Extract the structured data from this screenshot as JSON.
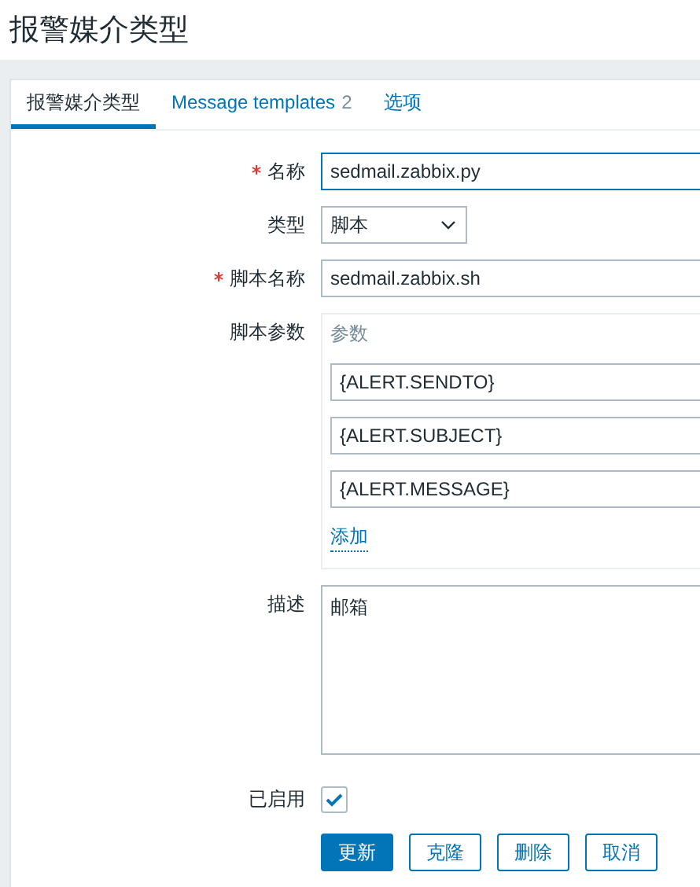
{
  "page": {
    "title": "报警媒介类型"
  },
  "tabs": [
    {
      "label": "报警媒介类型",
      "selected": true
    },
    {
      "label": "Message templates",
      "count": "2",
      "selected": false
    },
    {
      "label": "选项",
      "selected": false
    }
  ],
  "form": {
    "name": {
      "label": "名称",
      "required": true,
      "value": "sedmail.zabbix.py"
    },
    "type": {
      "label": "类型",
      "value": "脚本"
    },
    "script_name": {
      "label": "脚本名称",
      "required": true,
      "value": "sedmail.zabbix.sh"
    },
    "script_params": {
      "label": "脚本参数",
      "header": "参数",
      "values": [
        "{ALERT.SENDTO}",
        "{ALERT.SUBJECT}",
        "{ALERT.MESSAGE}"
      ],
      "add_link": "添加"
    },
    "description": {
      "label": "描述",
      "value": "邮箱"
    },
    "enabled": {
      "label": "已启用",
      "checked": true
    }
  },
  "buttons": [
    {
      "label": "更新",
      "primary": true
    },
    {
      "label": "克隆",
      "primary": false
    },
    {
      "label": "删除",
      "primary": false
    },
    {
      "label": "取消",
      "primary": false
    }
  ]
}
